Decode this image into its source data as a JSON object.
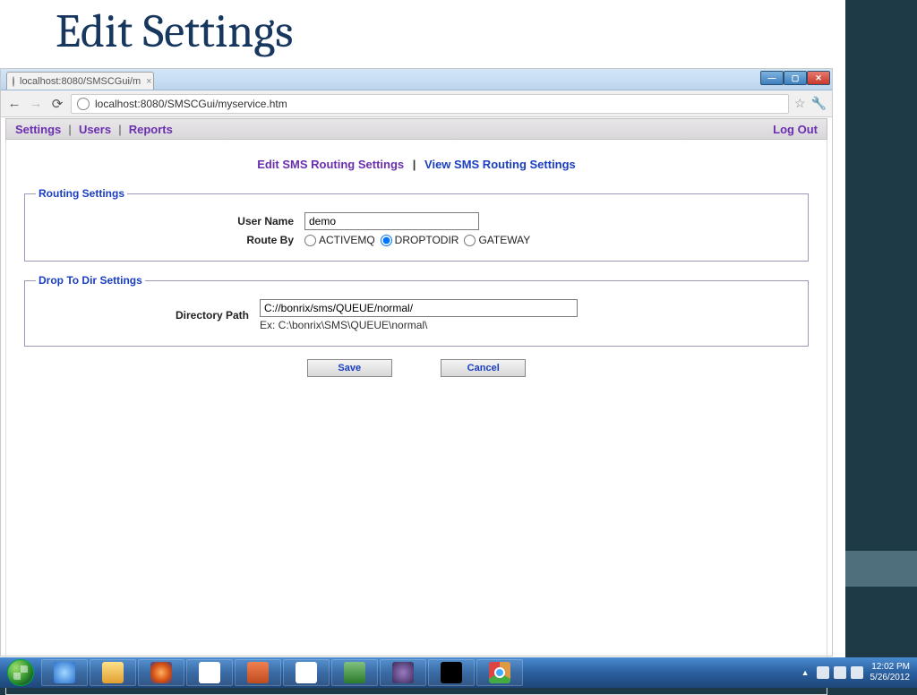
{
  "slide": {
    "title": "Edit Settings"
  },
  "browser": {
    "tab_title": "localhost:8080/SMSCGui/m",
    "url": "localhost:8080/SMSCGui/myservice.htm"
  },
  "menubar": {
    "settings": "Settings",
    "users": "Users",
    "reports": "Reports",
    "logout": "Log Out"
  },
  "sublinks": {
    "edit": "Edit SMS Routing Settings",
    "view": "View SMS Routing Settings"
  },
  "routing": {
    "legend": "Routing Settings",
    "username_label": "User Name",
    "username_value": "demo",
    "routeby_label": "Route By",
    "opt_activemq": "ACTIVEMQ",
    "opt_droptodir": "DROPTODIR",
    "opt_gateway": "GATEWAY",
    "selected": "DROPTODIR"
  },
  "droptodir": {
    "legend": "Drop To Dir Settings",
    "path_label": "Directory Path",
    "path_value": "C://bonrix/sms/QUEUE/normal/",
    "hint": "Ex: C:\\bonrix\\SMS\\QUEUE\\normal\\"
  },
  "buttons": {
    "save": "Save",
    "cancel": "Cancel"
  },
  "taskbar": {
    "time": "12:02 PM",
    "date": "5/26/2012"
  }
}
